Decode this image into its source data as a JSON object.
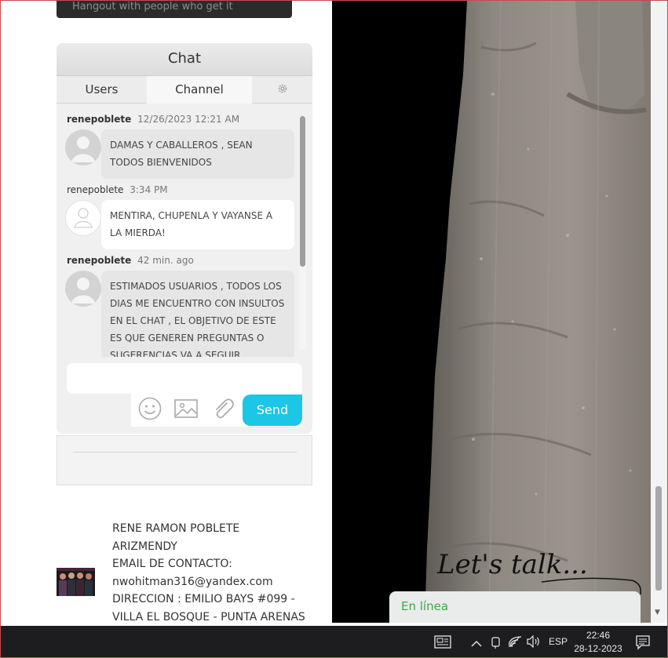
{
  "banner": {
    "text": "Hangout with people who get it"
  },
  "chat": {
    "title": "Chat",
    "tabs": {
      "users": "Users",
      "channel": "Channel"
    },
    "messages": [
      {
        "author": "renepoblete",
        "time": "12/26/2023 12:21 AM",
        "text": "DAMAS Y CABALLEROS , SEAN TODOS BIENVENIDOS"
      },
      {
        "author": "renepoblete",
        "time": "3:34 PM",
        "text": "MENTIRA, CHUPENLA Y VAYANSE A LA MIERDA!"
      },
      {
        "author": "renepoblete",
        "time": "42 min. ago",
        "text": "ESTIMADOS USUARIOS , TODOS LOS DIAS ME ENCUENTRO CON INSULTOS EN EL CHAT , EL OBJETIVO DE ESTE ES QUE GENEREN PREGUNTAS O SUGERENCIAS VA A SEGUIR"
      }
    ],
    "input": {
      "value": ""
    },
    "send_label": "Send"
  },
  "contact": {
    "lines": [
      "RENE RAMON POBLETE",
      "ARIZMENDY",
      "EMAIL DE CONTACTO:",
      "nwohitman316@yandex.com",
      "DIRECCION : EMILIO BAYS #099 -",
      "VILLA EL BOSQUE - PUNTA ARENAS"
    ]
  },
  "widget": {
    "lets_talk": "Let's talk...",
    "status": "En línea"
  },
  "taskbar": {
    "language": "ESP",
    "time": "22:46",
    "date": "28-12-2023"
  },
  "colors": {
    "send": "#1cc6e6",
    "online": "#3aa84a",
    "taskbar": "#1d1d20"
  }
}
